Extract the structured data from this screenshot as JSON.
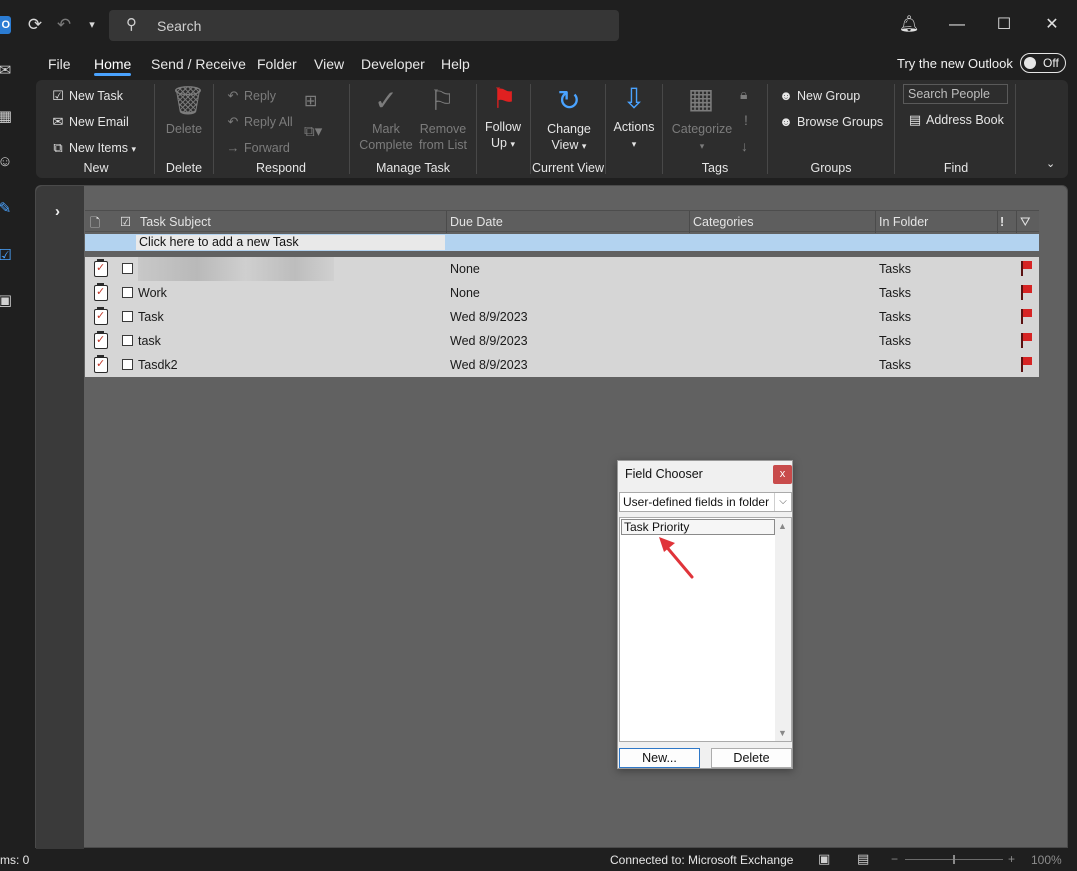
{
  "titlebar": {
    "logo_letter": "O",
    "search_placeholder": "Search"
  },
  "menu": {
    "tabs": [
      "File",
      "Home",
      "Send / Receive",
      "Folder",
      "View",
      "Developer",
      "Help"
    ],
    "active_tab": "Home",
    "try_new_label": "Try the new Outlook",
    "toggle_label": "Off"
  },
  "ribbon": {
    "new_group": {
      "new_task": "New Task",
      "new_email": "New Email",
      "new_items": "New Items",
      "label": "New"
    },
    "delete_group": {
      "delete": "Delete",
      "label": "Delete"
    },
    "respond_group": {
      "reply": "Reply",
      "reply_all": "Reply All",
      "forward": "Forward",
      "label": "Respond"
    },
    "manage_group": {
      "mark_complete_1": "Mark",
      "mark_complete_2": "Complete",
      "remove_1": "Remove",
      "remove_2": "from List",
      "label": "Manage Task"
    },
    "follow_up": {
      "line1": "Follow",
      "line2": "Up"
    },
    "current_view": {
      "line1": "Change",
      "line2": "View",
      "label": "Current View"
    },
    "actions": {
      "label": "Actions"
    },
    "tags_group": {
      "categorize": "Categorize",
      "label": "Tags"
    },
    "groups_group": {
      "new_group": "New Group",
      "browse_groups": "Browse Groups",
      "label": "Groups"
    },
    "find_group": {
      "search_people_placeholder": "Search People",
      "address_book": "Address Book",
      "label": "Find"
    }
  },
  "grid": {
    "columns": [
      "Task Subject",
      "Due Date",
      "Categories",
      "In Folder",
      "!"
    ],
    "add_row_text": "Click here to add a new Task",
    "rows": [
      {
        "subject": "",
        "due": "None",
        "folder": "Tasks"
      },
      {
        "subject": "Work",
        "due": "None",
        "folder": "Tasks"
      },
      {
        "subject": "Task",
        "due": "Wed 8/9/2023",
        "folder": "Tasks"
      },
      {
        "subject": "task",
        "due": "Wed 8/9/2023",
        "folder": "Tasks"
      },
      {
        "subject": "Tasdk2",
        "due": "Wed 8/9/2023",
        "folder": "Tasks"
      }
    ]
  },
  "field_chooser": {
    "title": "Field Chooser",
    "close_glyph": "x",
    "dropdown_value": "User-defined fields in folder",
    "items": [
      "Task Priority"
    ],
    "new_button": "New...",
    "delete_button": "Delete"
  },
  "statusbar": {
    "items_text": "ms: 0",
    "connection": "Connected to: Microsoft Exchange",
    "zoom_minus": "−",
    "zoom_plus": "+",
    "zoom": "100%"
  },
  "colors": {
    "accent": "#4aa3ff",
    "flag": "#d62424",
    "selection_row": "#b3d3f0"
  }
}
